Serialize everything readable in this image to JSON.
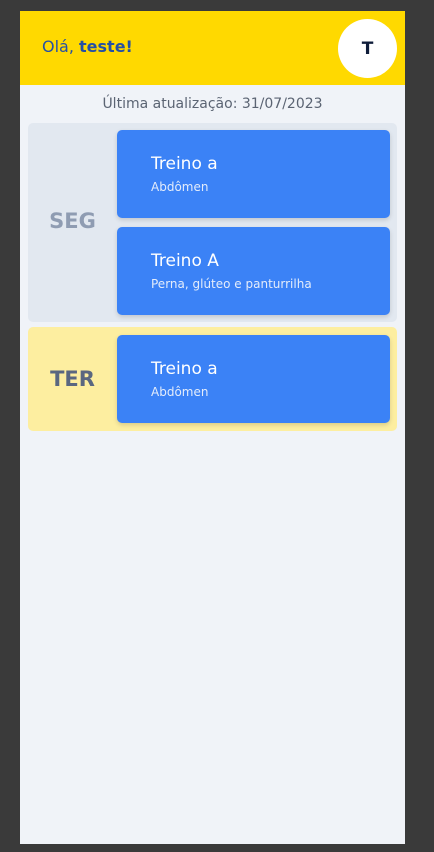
{
  "header": {
    "greeting_prefix": "Olá, ",
    "user_name": "teste!",
    "avatar_initial": "T"
  },
  "last_update": "Última atualização: 31/07/2023",
  "days": [
    {
      "label": "SEG",
      "label_color": "#8f9cb2",
      "background": "#e2e8f0",
      "workouts": [
        {
          "title": "Treino a",
          "subtitle": "Abdômen"
        },
        {
          "title": "Treino A",
          "subtitle": "Perna, glúteo e panturrilha"
        }
      ]
    },
    {
      "label": "TER",
      "label_color": "#5a6780",
      "background": "#fdeea0",
      "workouts": [
        {
          "title": "Treino a",
          "subtitle": "Abdômen"
        }
      ]
    }
  ],
  "colors": {
    "header_bg": "#ffd900",
    "accent_blue": "#3b82f6",
    "greeting_text": "#2550a4"
  }
}
